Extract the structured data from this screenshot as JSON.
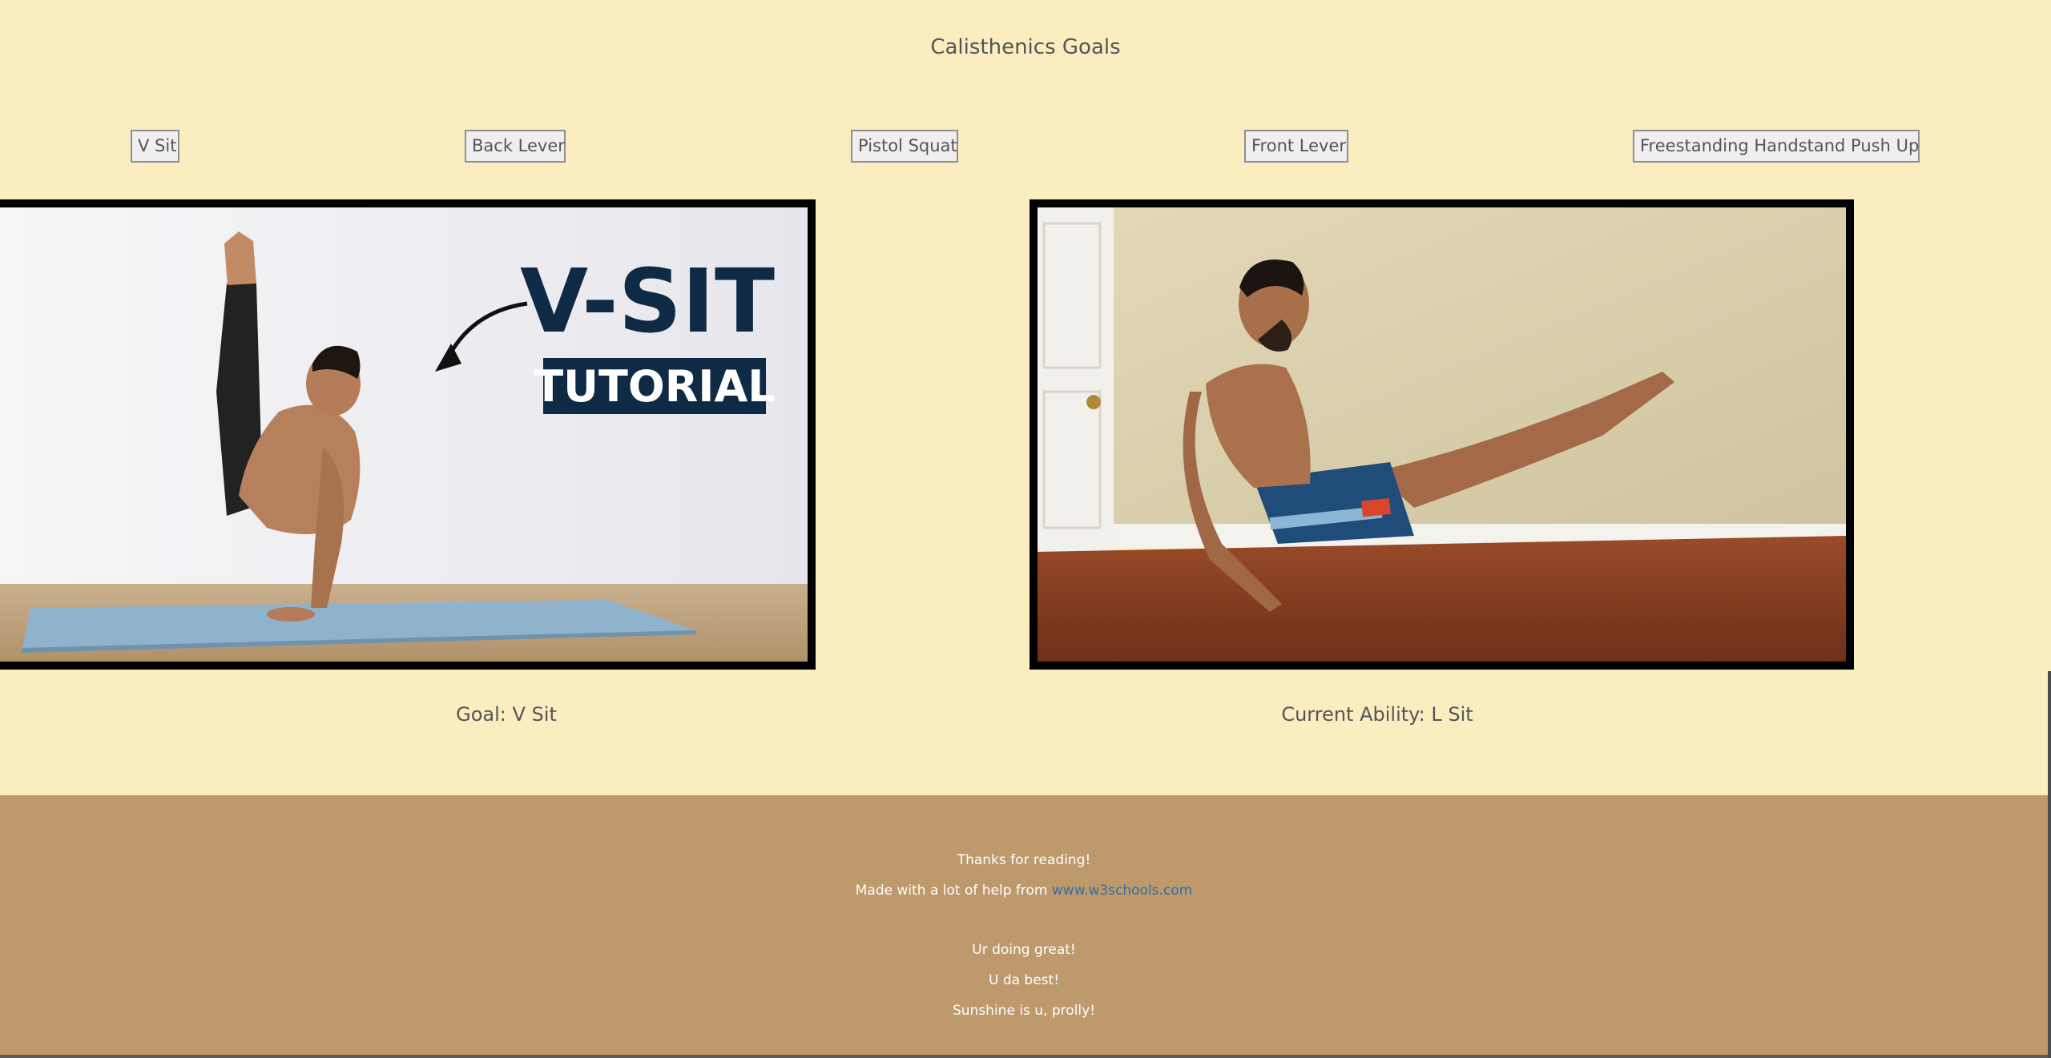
{
  "page": {
    "title": "Calisthenics Goals"
  },
  "nav": {
    "buttons": [
      "V Sit",
      "Back Lever",
      "Pistol Squat",
      "Front Lever",
      "Freestanding Handstand Push Up"
    ]
  },
  "goal_photo": {
    "heading": "V-SIT",
    "subheading": "TUTORIAL",
    "caption": "Goal: V Sit"
  },
  "current_photo": {
    "caption": "Current Ability: L Sit"
  },
  "footer": {
    "thanks": "Thanks for reading!",
    "made_with_prefix": "Made with a lot of help from ",
    "made_with_link": "www.w3schools.com",
    "line3": "Ur doing great!",
    "line4": "U da best!",
    "line5": "Sunshine is u, prolly!"
  },
  "colors": {
    "page_background": "#faedc0",
    "footer_background": "#bd996c",
    "link": "#2f6fa8",
    "tutorial_navy": "#0f2a44"
  }
}
